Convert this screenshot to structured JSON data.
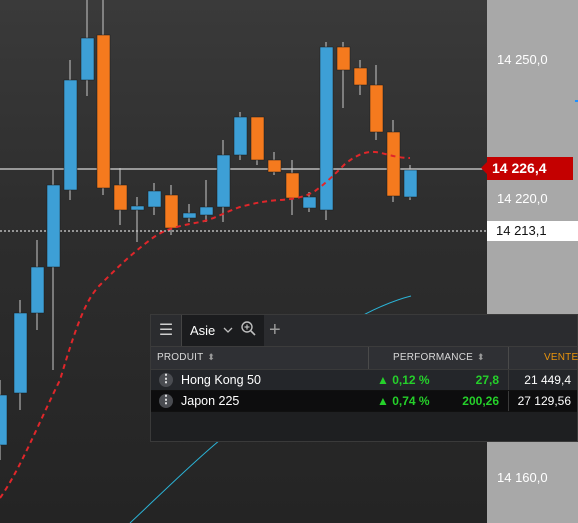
{
  "price_axis": {
    "ticks": [
      "14 250,0",
      "14 220,0",
      "14 160,0"
    ],
    "current_price": "14 226,4",
    "reference_price": "14 213,1"
  },
  "watchlist": {
    "tab_label": "Asie",
    "columns": {
      "product": "PRODUIT",
      "performance": "PERFORMANCE",
      "sell": "VENTE"
    },
    "rows": [
      {
        "name": "Hong Kong 50",
        "pct": "▲ 0,12 %",
        "change": "27,8",
        "sell": "21 449,4"
      },
      {
        "name": "Japon 225",
        "pct": "▲ 0,74 %",
        "change": "200,26",
        "sell": "27 129,56"
      }
    ]
  },
  "colors": {
    "up_candle": "#3d9fd6",
    "down_candle": "#f57a1e",
    "moving_average": "#e0262a",
    "positive": "#25d02a",
    "current_price_bg": "#c40000",
    "column_accent": "#e8930c"
  },
  "icons": {
    "menu": "hamburger-icon",
    "tab_dropdown": "chevron-down-icon",
    "zoom": "zoom-in-icon",
    "add": "plus-icon"
  }
}
